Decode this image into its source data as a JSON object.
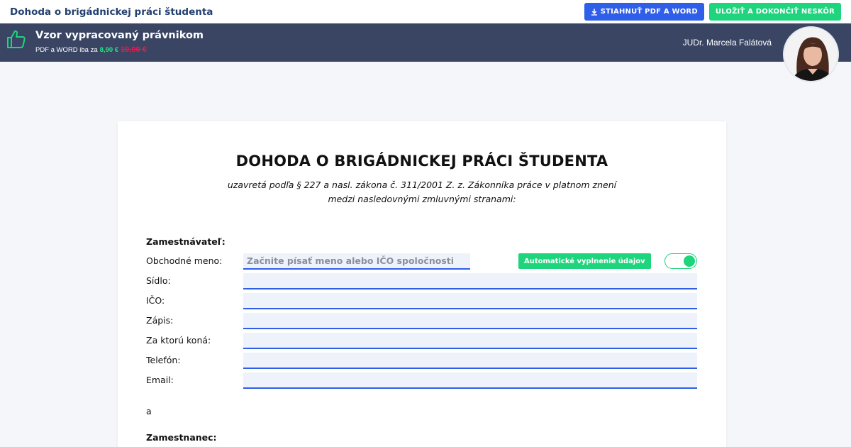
{
  "header": {
    "title": "Dohoda o brigádnickej práci študenta",
    "download_label": "STIAHNUŤ PDF A WORD",
    "save_label": "ULOŽIŤ A DOKONČIŤ NESKÔR"
  },
  "promo": {
    "title": "Vzor vypracovaný právnikom",
    "subtitle": "PDF a WORD iba za",
    "price_new": "8,90 €",
    "price_old": "10,90 €",
    "lawyer_name": "JUDr. Marcela Falátová"
  },
  "document": {
    "title": "DOHODA O BRIGÁDNICKEJ PRÁCI ŠTUDENTA",
    "subtitle_line1": "uzavretá podľa § 227 a nasl. zákona č. 311/2001 Z. z. Zákonníka práce v platnom znení",
    "subtitle_line2": "medzi nasledovnými zmluvnými stranami:",
    "employer_heading": "Zamestnávateľ:",
    "fields": {
      "company_name_label": "Obchodné meno:",
      "company_name_placeholder": "Začnite písať meno alebo IČO spoločnosti",
      "seat_label": "Sídlo:",
      "ico_label": "IČO:",
      "registration_label": "Zápis:",
      "representative_label": "Za ktorú koná:",
      "phone_label": "Telefón:",
      "email_label": "Email:"
    },
    "autofill_label": "Automatické vyplnenie údajov",
    "autofill_enabled": true,
    "conjunction": "a",
    "employee_heading": "Zamestnanec:"
  },
  "colors": {
    "primary_blue": "#2f5ee8",
    "accent_green": "#1ed47c",
    "band_dark": "#3a4563",
    "title_navy": "#24406e",
    "price_red": "#e8174f"
  }
}
